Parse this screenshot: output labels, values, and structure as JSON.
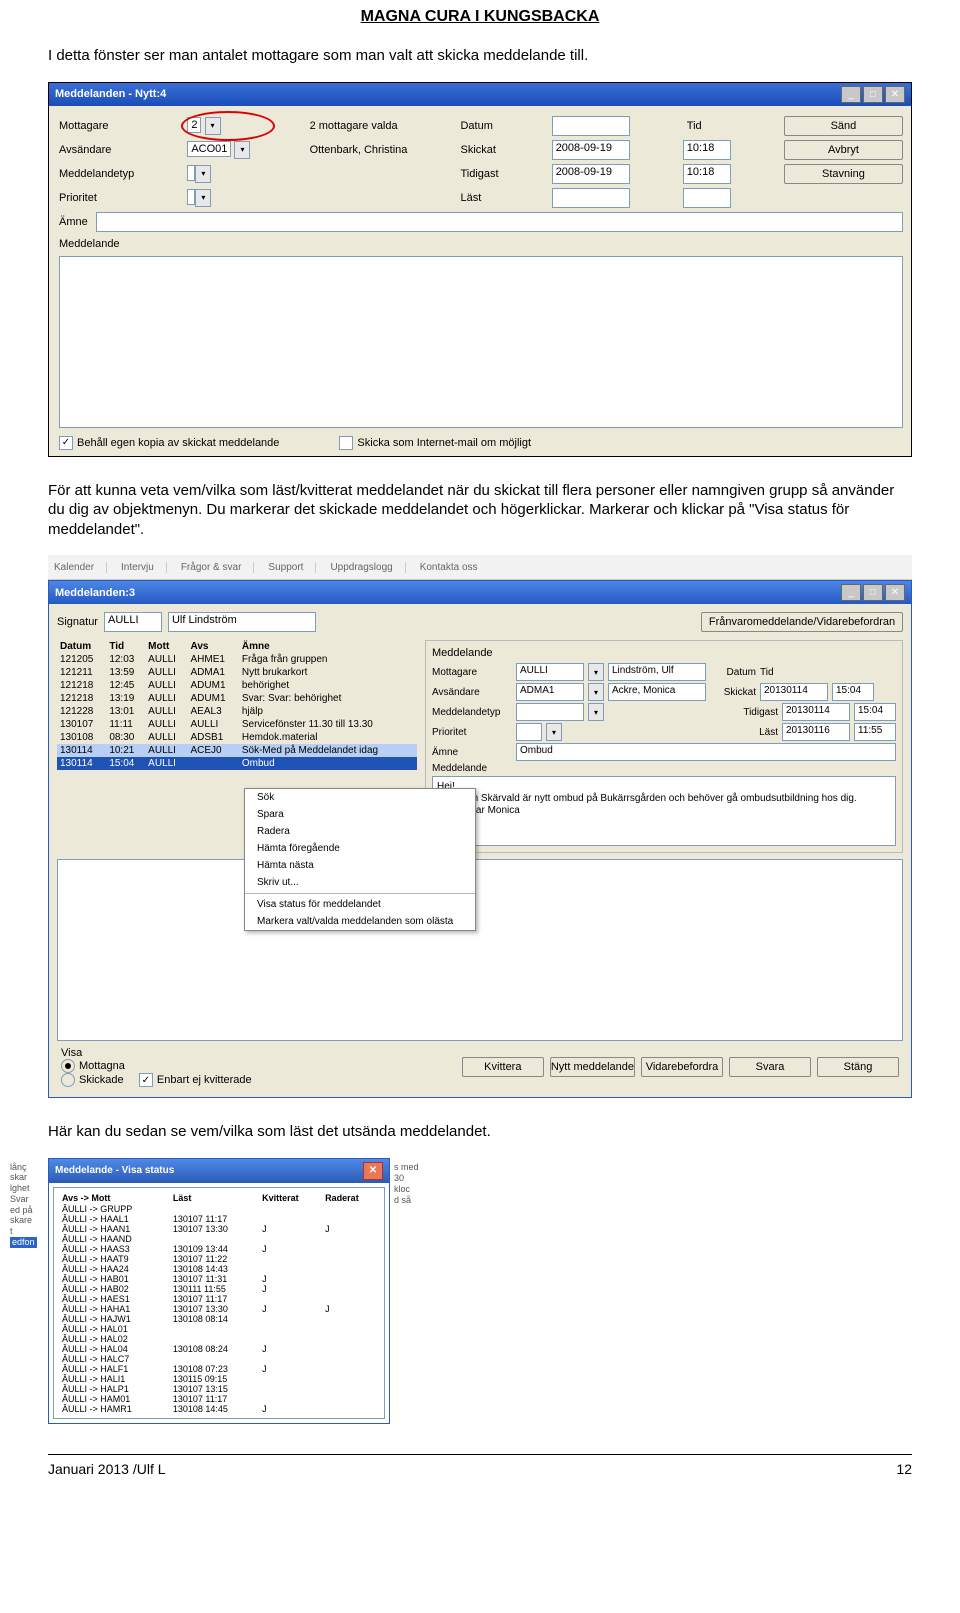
{
  "header": {
    "title": "MAGNA CURA I KUNGSBACKA"
  },
  "para1": "I detta fönster ser man antalet mottagare som man valt att skicka meddelande till.",
  "para2": "För att kunna veta vem/vilka som läst/kvitterat meddelandet när du skickat till flera personer eller namngiven grupp så använder du dig av objektmenyn. Du markerar det skickade meddelandet och högerklickar. Markerar och klickar på \"Visa status för meddelandet\".",
  "para3": "Här kan du sedan se vem/vilka som läst det utsända meddelandet.",
  "footer": {
    "left": "Januari 2013 /Ulf L",
    "right": "12"
  },
  "win1": {
    "title": "Meddelanden - Nytt:4",
    "labels": {
      "mottagare": "Mottagare",
      "avsandare": "Avsändare",
      "meddelandetyp": "Meddelandetyp",
      "prioritet": "Prioritet",
      "amne": "Ämne",
      "meddelande": "Meddelande",
      "datum": "Datum",
      "tid": "Tid",
      "skickat": "Skickat",
      "tidigast": "Tidigast",
      "last": "Läst"
    },
    "values": {
      "mottagare_count": "2",
      "mottagare_note": "2 mottagare valda",
      "avsandare_code": "ACO01",
      "avsandare_name": "Ottenbark, Christina",
      "skickat_date": "2008-09-19",
      "skickat_tid": "10:18",
      "tidigast_date": "2008-09-19",
      "tidigast_tid": "10:18"
    },
    "buttons": {
      "sand": "Sänd",
      "avbryt": "Avbryt",
      "stavning": "Stavning"
    },
    "check1_label": "Behåll egen kopia av skickat meddelande",
    "check1_checked": "✓",
    "check2_label": "Skicka som Internet-mail om möjligt"
  },
  "toolbar2_items": [
    "Kalender",
    "Intervju",
    "Frågor & svar",
    "Support",
    "Uppdragslogg",
    "Kontakta oss"
  ],
  "win2": {
    "title": "Meddelanden:3",
    "signatur_lbl": "Signatur",
    "signatur_code": "AULLI",
    "signatur_name": "Ulf Lindström",
    "franv_btn": "Frånvaromeddelande/Vidarebefordran",
    "left_headers": [
      "Datum",
      "Tid",
      "Mott",
      "Avs",
      "Ämne"
    ],
    "rows": [
      [
        "121205",
        "12:03",
        "AULLI",
        "AHME1",
        "Fråga från gruppen"
      ],
      [
        "121211",
        "13:59",
        "AULLI",
        "ADMA1",
        "Nytt brukarkort"
      ],
      [
        "121218",
        "12:45",
        "AULLI",
        "ADUM1",
        "behörighet"
      ],
      [
        "121218",
        "13:19",
        "AULLI",
        "ADUM1",
        "Svar: Svar: behörighet"
      ],
      [
        "121228",
        "13:01",
        "AULLI",
        "AEAL3",
        "hjälp"
      ],
      [
        "130107",
        "11:11",
        "AULLI",
        "AULLI",
        "Servicefönster 11.30 till 13.30"
      ],
      [
        "130108",
        "08:30",
        "AULLI",
        "ADSB1",
        "Hemdok.material"
      ],
      [
        "130114",
        "10:21",
        "AULLI",
        "ACEJ0",
        "Sök-Med på Meddelandet idag"
      ],
      [
        "130114",
        "15:04",
        "AULLI",
        "",
        "Ombud"
      ]
    ],
    "ctx_items": [
      "Sök",
      "Spara",
      "Radera",
      "Hämta föregående",
      "Hämta nästa",
      "Skriv ut...",
      "Visa status för meddelandet",
      "Markera valt/valda meddelanden som olästa"
    ],
    "right_panel": {
      "heading": "Meddelande",
      "labels": {
        "mottagare": "Mottagare",
        "avsandare": "Avsändare",
        "meddelandetyp": "Meddelandetyp",
        "prioritet": "Prioritet",
        "amne": "Ämne",
        "meddelande": "Meddelande",
        "datum": "Datum",
        "tid": "Tid",
        "skickat": "Skickat",
        "tidigast": "Tidigast",
        "last": "Läst"
      },
      "values": {
        "mottagare_code": "AULLI",
        "mottagare_name": "Lindström, Ulf",
        "avsandare_code": "ADMA1",
        "avsandare_name": "Ackre, Monica",
        "skickat_date": "20130114",
        "skickat_tid": "15:04",
        "tidigast_date": "20130114",
        "tidigast_tid": "15:04",
        "last_date": "20130116",
        "last_tid": "11:55",
        "amne_val": "Ombud",
        "msg_line1": "Hej!",
        "msg_line2": "Elisabeth Skärvald är nytt ombud på Bukärrsgården och behöver gå ombudsutbildning hos dig.",
        "msg_line3": "Hälsningar Monica"
      }
    },
    "footer": {
      "visa": "Visa",
      "mottagna": "Mottagna",
      "skickade": "Skickade",
      "enbart": "Enbart ej kvitterade",
      "btns": [
        "Kvittera",
        "Nytt meddelande",
        "Vidarebefordra",
        "Svara",
        "Stäng"
      ]
    }
  },
  "win3": {
    "title": "Meddelande - Visa status",
    "headers": [
      "Avs -> Mott",
      "Läst",
      "Kvitterat",
      "Raderat"
    ],
    "rows": [
      [
        "ÂULLI -> GRUPP",
        "",
        "",
        ""
      ],
      [
        "ÂULLI -> HAAL1",
        "130107 11:17",
        "",
        ""
      ],
      [
        "ÂULLI -> HAAN1",
        "130107 13:30",
        "J",
        "J"
      ],
      [
        "ÂULLI -> HAAND",
        "",
        "",
        ""
      ],
      [
        "ÂULLI -> HAAS3",
        "130109 13:44",
        "J",
        ""
      ],
      [
        "ÂULLI -> HAAT9",
        "130107 11:22",
        "",
        ""
      ],
      [
        "ÂULLI -> HAA24",
        "130108 14:43",
        "",
        ""
      ],
      [
        "ÂULLI -> HAB01",
        "130107 11:31",
        "J",
        ""
      ],
      [
        "ÂULLI -> HAB02",
        "130111 11:55",
        "J",
        ""
      ],
      [
        "ÂULLI -> HAES1",
        "130107 11:17",
        "",
        ""
      ],
      [
        "ÂULLI -> HAHA1",
        "130107 13:30",
        "J",
        "J"
      ],
      [
        "ÂULLI -> HAJW1",
        "130108 08:14",
        "",
        ""
      ],
      [
        "ÂULLI -> HAL01",
        "",
        "",
        ""
      ],
      [
        "ÂULLI -> HAL02",
        "",
        "",
        ""
      ],
      [
        "ÂULLI -> HAL04",
        "130108 08:24",
        "J",
        ""
      ],
      [
        "ÂULLI -> HALC7",
        "",
        "",
        ""
      ],
      [
        "ÂULLI -> HALF1",
        "130108 07:23",
        "J",
        ""
      ],
      [
        "ÂULLI -> HALI1",
        "130115 09:15",
        "",
        ""
      ],
      [
        "ÂULLI -> HALP1",
        "130107 13:15",
        "",
        ""
      ],
      [
        "ÂULLI -> HAM01",
        "130107 11:17",
        "",
        ""
      ],
      [
        "ÂULLI -> HAMR1",
        "130108 14:45",
        "J",
        ""
      ]
    ]
  },
  "side_frags_left": [
    "lånç",
    "skar",
    "lghet",
    "Svar",
    "ed på",
    "skare",
    "t",
    "edfon"
  ],
  "side_frags_right": [
    "s med",
    "30",
    "kloc",
    "d så"
  ]
}
